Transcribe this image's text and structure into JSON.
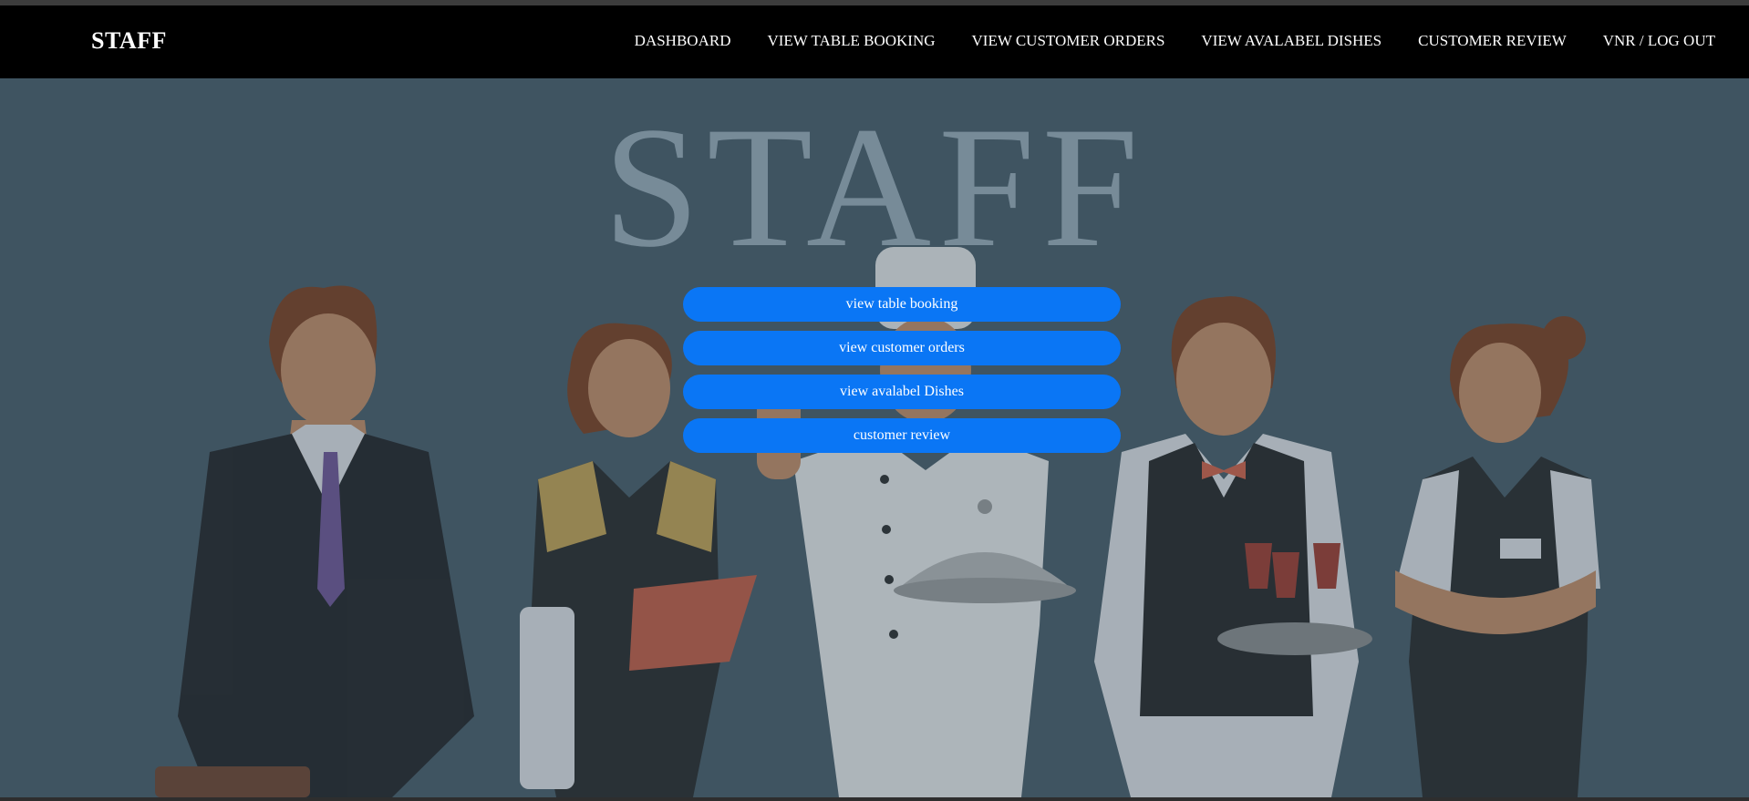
{
  "navbar": {
    "brand": "STAFF",
    "links": [
      {
        "label": "DASHBOARD"
      },
      {
        "label": "VIEW TABLE BOOKING"
      },
      {
        "label": "VIEW CUSTOMER ORDERS"
      },
      {
        "label": "VIEW AVALABEL DISHES"
      },
      {
        "label": "CUSTOMER REVIEW"
      },
      {
        "label": "VNR / LOG OUT"
      }
    ]
  },
  "hero": {
    "title": "STAFF",
    "buttons": [
      {
        "label": "view table booking"
      },
      {
        "label": "view customer orders"
      },
      {
        "label": "view avalabel Dishes"
      },
      {
        "label": "customer review"
      }
    ]
  },
  "colors": {
    "navbar_bg": "#000000",
    "hero_bg": "#3f5461",
    "button_bg": "#0a76f5",
    "title_color": "#778b98"
  }
}
